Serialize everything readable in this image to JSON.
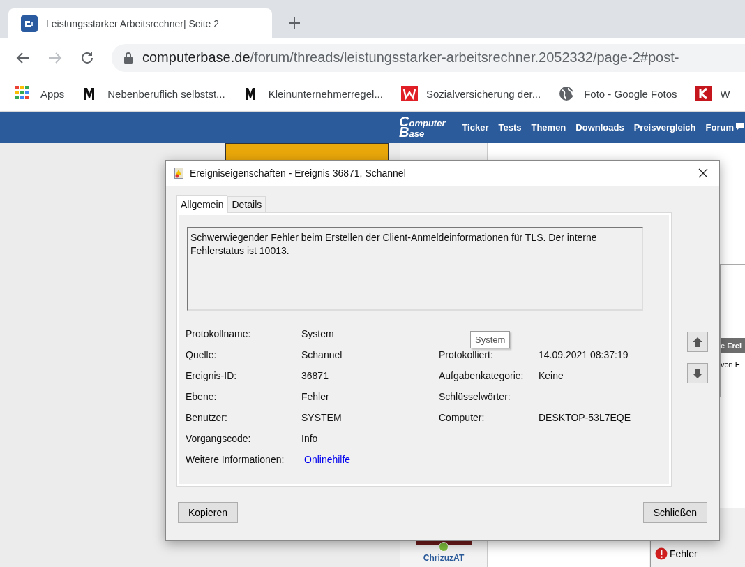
{
  "browser": {
    "tab": {
      "title": "Leistungsstarker Arbeitsrechner| Seite 2"
    },
    "address": {
      "host": "computerbase.de",
      "path": "/forum/threads/leistungsstarker-arbeitsrechner.2052332/page-2#post-"
    },
    "bookmarks": [
      {
        "kind": "apps",
        "label": "Apps"
      },
      {
        "kind": "m",
        "label": "Nebenberuflich selbstst..."
      },
      {
        "kind": "m",
        "label": "Kleinunternehmerregel..."
      },
      {
        "kind": "w",
        "label": "Sozialversicherung der..."
      },
      {
        "kind": "globe",
        "label": "Foto - Google Fotos"
      },
      {
        "kind": "k",
        "label": "W"
      }
    ]
  },
  "site_nav": {
    "logo": [
      "Computer",
      "Base"
    ],
    "items": [
      "Ticker",
      "Tests",
      "Themen",
      "Downloads",
      "Preisvergleich",
      "Forum"
    ]
  },
  "background": {
    "side_tabs": [
      "e Erei",
      "von E"
    ],
    "user": "ChrizuzAT",
    "status": "Fehler"
  },
  "dialog": {
    "title": "Ereigniseigenschaften - Ereignis 36871, Schannel",
    "tabs": [
      {
        "label": "Allgemein",
        "selected": true
      },
      {
        "label": "Details",
        "selected": false
      }
    ],
    "description": "Schwerwiegender Fehler beim Erstellen der Client-Anmeldeinformationen für TLS. Der interne Fehlerstatus ist 10013.",
    "fields": [
      {
        "left": {
          "label": "Protokollname:",
          "value": "System"
        }
      },
      {
        "left": {
          "label": "Quelle:",
          "value": "Schannel"
        },
        "right": {
          "label": "Protokolliert:",
          "value": "14.09.2021 08:37:19"
        }
      },
      {
        "left": {
          "label": "Ereignis-ID:",
          "value": "36871"
        },
        "right": {
          "label": "Aufgabenkategorie:",
          "value": "Keine"
        }
      },
      {
        "left": {
          "label": "Ebene:",
          "value": "Fehler"
        },
        "right": {
          "label": "Schlüsselwörter:"
        }
      },
      {
        "left": {
          "label": "Benutzer:",
          "value": "SYSTEM"
        },
        "right": {
          "label": "Computer:",
          "value": "DESKTOP-53L7EQE"
        }
      },
      {
        "left": {
          "label": "Vorgangscode:",
          "value": "Info"
        }
      },
      {
        "left": {
          "label": "Weitere Informationen:",
          "value": "Onlinehilfe",
          "kind": "link"
        }
      }
    ],
    "tooltip": "System",
    "buttons": [
      "Kopieren",
      "Schließen"
    ]
  }
}
